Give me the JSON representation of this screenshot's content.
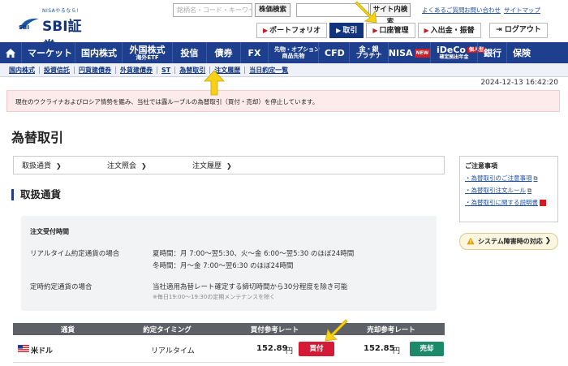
{
  "header": {
    "logo_tagline": "NISAやるなら!",
    "logo_text": "SBI証券",
    "search_placeholder": "銘柄名・コード・キーワード",
    "stock_search_label": "株価検索",
    "site_search_label": "サイト内検索",
    "util_links": [
      "よくあるご質問",
      "お問い合わせ",
      "サイトマップ"
    ],
    "tabs": [
      {
        "label": "ポートフォリオ",
        "active": false
      },
      {
        "label": "取引",
        "active": true
      },
      {
        "label": "口座管理",
        "active": false
      },
      {
        "label": "入出金・振替",
        "active": false
      }
    ],
    "logout_label": "ログアウト"
  },
  "nav": {
    "items": [
      {
        "label": "マーケット",
        "sub": ""
      },
      {
        "label": "国内株式",
        "sub": ""
      },
      {
        "label": "外国株式",
        "sub": "海外ETF"
      },
      {
        "label": "投信",
        "sub": ""
      },
      {
        "label": "債券",
        "sub": ""
      },
      {
        "label": "FX",
        "sub": ""
      },
      {
        "label": "先物・オプション",
        "sub": "商品先物"
      },
      {
        "label": "CFD",
        "sub": ""
      },
      {
        "label": "金・銀",
        "sub": "プラチナ"
      },
      {
        "label": "NISA",
        "sub": ""
      },
      {
        "label": "iDeCo",
        "sub": "確定拠出年金"
      },
      {
        "label": "銀行",
        "sub": ""
      },
      {
        "label": "保険",
        "sub": ""
      }
    ],
    "nisa_badge": "NEW",
    "ideco_badge": "個人型"
  },
  "subnav": {
    "items": [
      "国内株式",
      "投資信託",
      "円貨建債券",
      "外貨建債券",
      "ST",
      "為替取引",
      "注文履歴",
      "当日約定一覧"
    ],
    "active": "為替取引"
  },
  "datetime": "2024-12-13 16:42:20",
  "notice": "現在のウクライナおよびロシア情勢を鑑み、当社では露ルーブルの為替取引（買付・売却）を停止しています。",
  "page_title": "為替取引",
  "subtabs": [
    "取扱通貨",
    "注文照会",
    "注文履歴"
  ],
  "section_title": "取扱通貨",
  "hours": {
    "title": "注文受付時間",
    "realtime_label": "リアルタイム約定通貨の場合",
    "realtime_summer": "夏時間：月 7:00～翌5:30、火～金 6:00～翌5:30 のほぼ24時間",
    "realtime_winter": "冬時間：月～金 7:00～翌6:30 のほぼ24時間",
    "fixed_label": "定時約定通貨の場合",
    "fixed_value": "当社適用為替レート確定する締切時間から30分程度を除き可能",
    "fixed_note": "※毎日19:00～19:30の定期メンテナンスを除く"
  },
  "table": {
    "headers": [
      "通貨",
      "約定タイミング",
      "買付参考レート",
      "売却参考レート"
    ],
    "rows": [
      {
        "currency": "米ドル",
        "timing": "リアルタイム",
        "buy_rate": "152.89",
        "buy_unit": "円",
        "buy_label": "買付",
        "sell_rate": "152.85",
        "sell_unit": "円",
        "sell_label": "売却"
      }
    ]
  },
  "aside": {
    "title": "ご注意事項",
    "links": [
      "為替取引のご注意事項",
      "為替取引注文ルール",
      "為替取引に関する説明書"
    ]
  },
  "system_button": "システム障害時の対応",
  "colors": {
    "brand_navy": "#1d3f8e",
    "buy_red": "#d51a36",
    "sell_green": "#1c8a68",
    "notice_bg": "#fdeaea",
    "arrow_yellow": "#f7d117"
  }
}
